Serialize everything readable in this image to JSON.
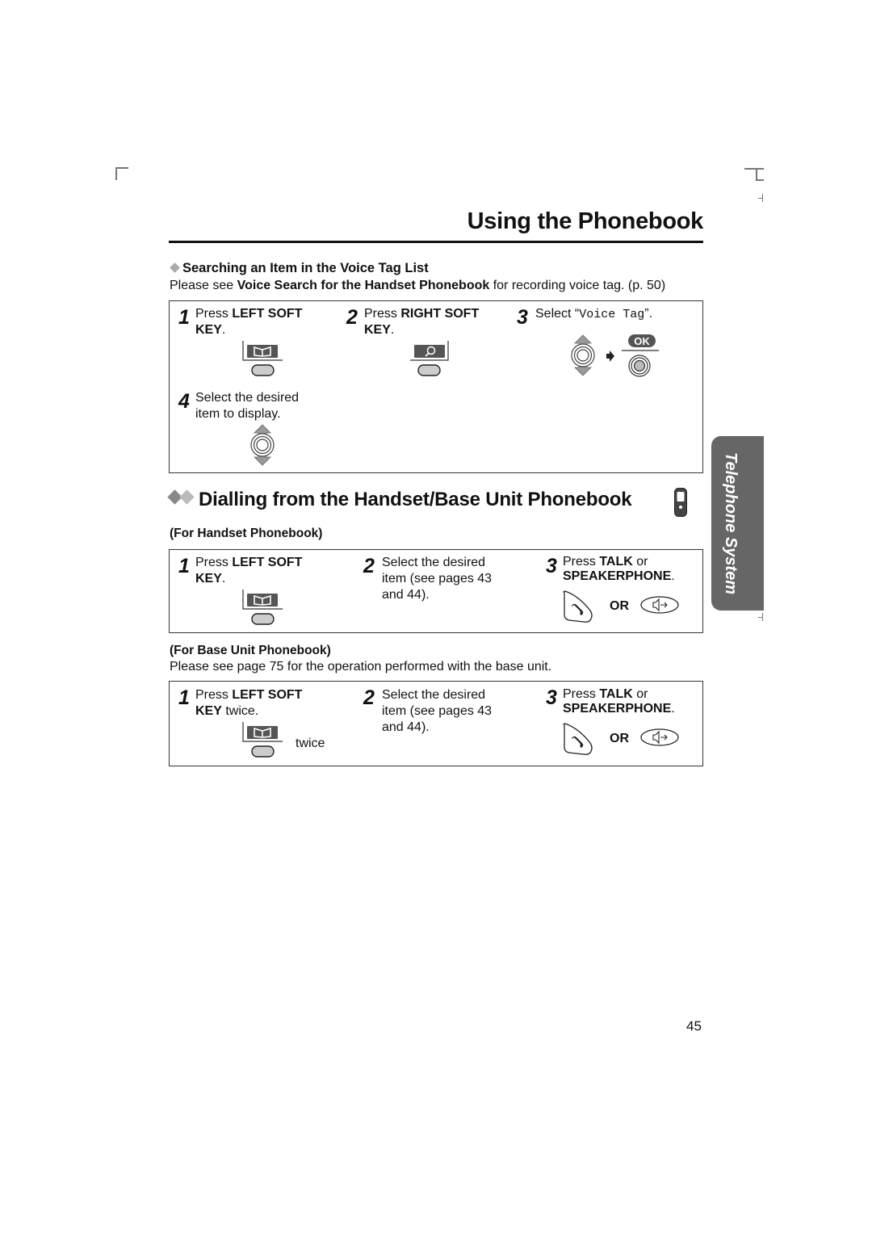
{
  "page": {
    "title": "Using the Phonebook",
    "page_number": "45",
    "side_tab": "Telephone System"
  },
  "voice_tag_section": {
    "heading": "Searching an Item in the Voice Tag List",
    "intro_prefix": "Please see ",
    "intro_bold": "Voice Search for the Handset Phonebook",
    "intro_suffix": " for recording voice tag. (p. 50)",
    "steps": [
      {
        "num": "1",
        "line1_prefix": "Press ",
        "line1_bold": "LEFT SOFT",
        "line2_bold": "KEY",
        "line2_suffix": ".",
        "icon": "phonebook-soft-key-icon"
      },
      {
        "num": "2",
        "line1_prefix": "Press ",
        "line1_bold": "RIGHT SOFT",
        "line2_bold": "KEY",
        "line2_suffix": ".",
        "icon": "search-soft-key-icon"
      },
      {
        "num": "3",
        "prefix": "Select “",
        "mono": "Voice Tag",
        "suffix": "”.",
        "icon": "navigator-then-ok-icon",
        "ok_label": "OK"
      },
      {
        "num": "4",
        "line1": "Select the desired",
        "line2": "item to display.",
        "icon": "navigator-key-icon"
      }
    ]
  },
  "dialling_section": {
    "heading": "Dialling from the Handset/Base Unit Phonebook",
    "handset": {
      "heading": "(For Handset Phonebook)",
      "steps": [
        {
          "num": "1",
          "line1_prefix": "Press ",
          "line1_bold": "LEFT SOFT",
          "line2_bold": "KEY",
          "line2_suffix": "."
        },
        {
          "num": "2",
          "line1": "Select the desired",
          "line2": "item (see pages 43",
          "line3": "and 44)."
        },
        {
          "num": "3",
          "line1_prefix": "Press ",
          "line1_bold": "TALK",
          "line1_suffix": " or",
          "line2_bold": "SPEAKERPHONE",
          "line2_suffix": ".",
          "or_label": "OR"
        }
      ]
    },
    "base": {
      "heading": "(For Base Unit Phonebook)",
      "intro": "Please see page 75 for the operation performed with the base unit.",
      "steps": [
        {
          "num": "1",
          "line1_prefix": "Press ",
          "line1_bold": "LEFT SOFT",
          "line2_bold": "KEY",
          "line2_suffix": " twice.",
          "icon_note": "twice"
        },
        {
          "num": "2",
          "line1": "Select the desired",
          "line2": "item (see pages 43",
          "line3": "and 44)."
        },
        {
          "num": "3",
          "line1_prefix": "Press ",
          "line1_bold": "TALK",
          "line1_suffix": " or",
          "line2_bold": "SPEAKERPHONE",
          "line2_suffix": ".",
          "or_label": "OR"
        }
      ]
    }
  },
  "colors": {
    "tab_bg": "#666666",
    "diamond_dark": "#888888",
    "diamond_light": "#bbbbbb",
    "key_fill": "#555555",
    "button_fill": "#cccccc"
  }
}
